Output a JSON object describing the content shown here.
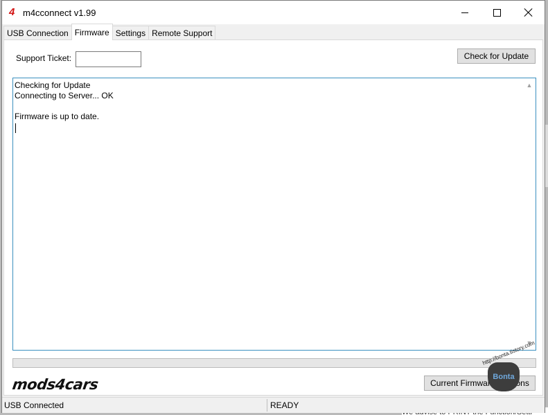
{
  "window": {
    "title": "m4cconnect v1.99",
    "icon": "mods4cars-logo-icon",
    "controls": [
      "minimize-icon",
      "maximize-icon",
      "close-icon"
    ]
  },
  "tabs": [
    {
      "label": "USB Connection",
      "active": false
    },
    {
      "label": "Firmware",
      "active": true
    },
    {
      "label": "Settings",
      "active": false
    },
    {
      "label": "Remote Support",
      "active": false
    }
  ],
  "firmware": {
    "support_ticket_label": "Support Ticket:",
    "support_ticket_value": "",
    "check_button": "Check for Update",
    "log": [
      "Checking for Update",
      "Connecting to Server... OK",
      "",
      "Firmware is up to date."
    ],
    "progress": 0,
    "current_firmware_button": "Current Firmware Versions",
    "logo_text": "mods4cars"
  },
  "status": {
    "left": "USB Connected",
    "right": "READY"
  },
  "watermark": {
    "arc_text": "http://bonta.tistory.com",
    "label": "Bonta"
  },
  "background": {
    "text": "We advise to PRINT the Function/Setti"
  },
  "colors": {
    "accent": "#3a8fbf",
    "brand_red": "#d21414"
  }
}
